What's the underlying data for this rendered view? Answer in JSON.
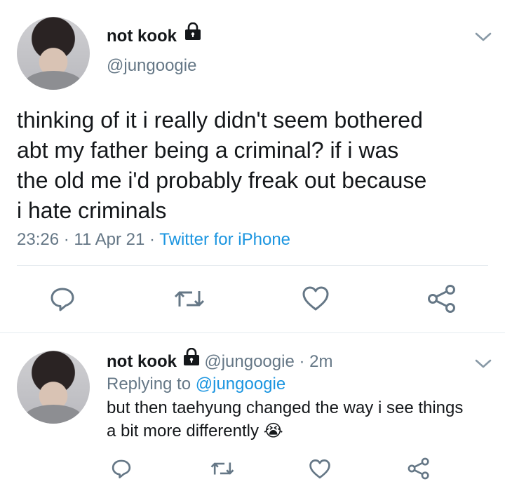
{
  "main_tweet": {
    "display_name": "not kook",
    "handle": "@jungoogie",
    "text_lines": [
      "thinking of it i really didn't seem bothered",
      "abt my father being a criminal? if i was",
      "the old me i'd probably freak out because",
      "i hate criminals"
    ],
    "time": "23:26",
    "date": "11 Apr 21",
    "separator": "·",
    "source": "Twitter for iPhone"
  },
  "reply_tweet": {
    "display_name": "not kook",
    "handle": "@jungoogie",
    "separator": "·",
    "age": "2m",
    "replying_prefix": "Replying to",
    "replying_handle": "@jungoogie",
    "text_lines": [
      "but then taehyung changed the way i see things",
      "a bit more differently"
    ],
    "emoji": "😭"
  },
  "icons": {
    "verified_lock": "lock-icon",
    "menu": "chevron-down-icon",
    "actions": [
      "reply-icon",
      "retweet-icon",
      "like-icon",
      "share-icon"
    ]
  },
  "colors": {
    "text": "#14171a",
    "muted": "#657786",
    "link": "#1b95e0",
    "icon": "#657786"
  }
}
